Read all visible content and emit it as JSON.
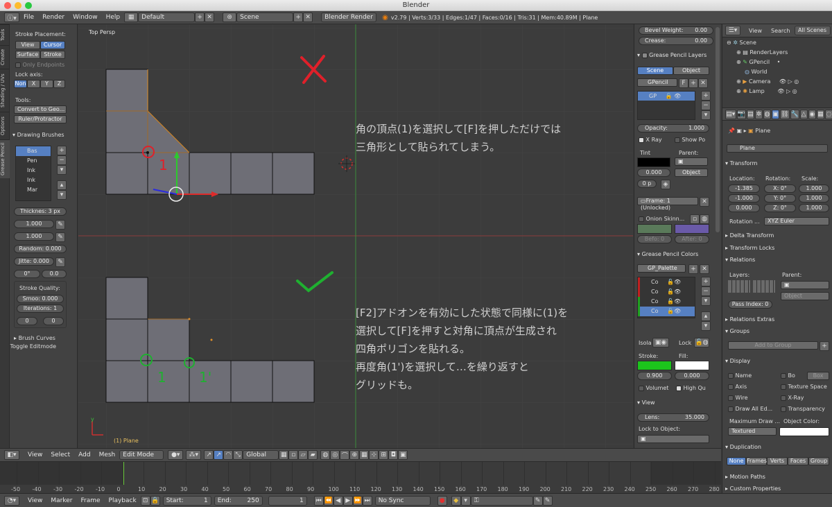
{
  "window": {
    "title": "Blender"
  },
  "topbar": {
    "menus": [
      "File",
      "Render",
      "Window",
      "Help"
    ],
    "layout": "Default",
    "scene": "Scene",
    "engine": "Blender Render",
    "stats": "v2.79 | Verts:3/33 | Edges:1/47 | Faces:0/16 | Tris:31 | Mem:40.89M | Plane"
  },
  "toolshelf": {
    "tabs": [
      "Tools",
      "Create",
      "Shading / UVs",
      "Options",
      "Grease Pencil"
    ],
    "stroke_placement": "Stroke Placement:",
    "view": "View",
    "cursor": "Cursor",
    "surface": "Surface",
    "stroke": "Stroke",
    "only_endpoints": "Only Endpoints",
    "lock_axis": "Lock axis:",
    "axes": [
      "Non",
      "X",
      "Y",
      "Z"
    ],
    "tools_label": "Tools:",
    "convert": "Convert to Geo...",
    "ruler": "Ruler/Protractor",
    "drawing_brushes": "Drawing Brushes",
    "brushes": [
      "Bas",
      "Pen",
      "Ink",
      "Ink",
      "Mar"
    ],
    "thickness": "Thicknes: 3 px",
    "val1": "1.000",
    "val2": "1.000",
    "random": "Random: 0.000",
    "jitter": "Jitte: 0.000",
    "angle": "0°",
    "angle_val": "0.0",
    "stroke_quality": "Stroke Quality:",
    "smooth": "Smoo: 0.000",
    "iterations_label": "Iterations:",
    "iterations": "1",
    "q1": "0",
    "q2": "0",
    "brush_curves": "Brush Curves",
    "toggle_editmode": "Toggle Editmode"
  },
  "viewport": {
    "label": "Top Persp",
    "object_label": "(1) Plane",
    "text1": [
      "角の頂点(1)を選択して[F]を押しただけでは",
      "三角形として貼られてしまう。"
    ],
    "text2": [
      "[F2]アドオンを有効にした状態で同様に(1)を",
      "選択して[F]を押すと対角に頂点が生成され",
      "四角ポリゴンを貼れる。",
      "再度角(1')を選択して…を繰り返すと",
      "グリッドも。"
    ],
    "mark1": "1",
    "mark2": "1",
    "mark3": "1'",
    "axis_y": "y",
    "colors": {
      "bad": "#e0202a",
      "good": "#1fb030",
      "face": "#6e6e76"
    }
  },
  "viewport_header": {
    "menus": [
      "View",
      "Select",
      "Add",
      "Mesh"
    ],
    "mode": "Edit Mode",
    "orientation": "Global"
  },
  "timeline": {
    "ticks": [
      "-50",
      "-40",
      "-30",
      "-20",
      "-10",
      "0",
      "10",
      "20",
      "30",
      "40",
      "50",
      "60",
      "70",
      "80",
      "90",
      "100",
      "110",
      "120",
      "130",
      "140",
      "150",
      "160",
      "170",
      "180",
      "190",
      "200",
      "210",
      "220",
      "230",
      "240",
      "250",
      "260",
      "270",
      "280"
    ]
  },
  "bottombar": {
    "menus": [
      "View",
      "Marker",
      "Frame",
      "Playback"
    ],
    "start_label": "Start:",
    "start": "1",
    "end_label": "End:",
    "end": "250",
    "current": "1",
    "sync": "No Sync"
  },
  "npanel": {
    "bevel_weight": "Bevel Weight:",
    "bevel_val": "0.00",
    "crease": "Crease:",
    "crease_val": "0.00",
    "gp_layers": "Grease Pencil Layers",
    "scene_btn": "Scene",
    "object_btn": "Object",
    "gpencil": "GPencil",
    "f_btn": "F",
    "layer": "GP",
    "opacity": "Opacity:",
    "opacity_val": "1.000",
    "xray": "X Ray",
    "showpo": "Show Po",
    "tint": "Tint",
    "parent": "Parent:",
    "tint_val": "0.000",
    "object_sel": "Object",
    "px": "0 p",
    "frame": "Frame: 1 (Unlocked)",
    "onion": "Onion Skinn...",
    "before": "Befo: 0",
    "after": "After: 0",
    "gp_colors": "Grease Pencil Colors",
    "palette": "GP_Palette",
    "color_items": [
      "Co",
      "Co",
      "Co",
      "Co"
    ],
    "isola": "Isola",
    "lock": "Lock",
    "stroke": "Stroke:",
    "fill": "Fill:",
    "stroke_val": "0.900",
    "fill_val": "0.000",
    "volumet": "Volumet",
    "highqu": "High Qu",
    "view": "View",
    "lens": "Lens:",
    "lens_val": "35.000",
    "lock_obj": "Lock to Object:"
  },
  "outliner": {
    "view": "View",
    "search": "Search",
    "all_scenes": "All Scenes",
    "items": [
      "Scene",
      "RenderLayers",
      "GPencil",
      "World",
      "Camera",
      "Lamp"
    ]
  },
  "properties": {
    "object_path": "Plane",
    "name": "Plane",
    "transform": "Transform",
    "location": "Location:",
    "rotation": "Rotation:",
    "scale": "Scale:",
    "loc": [
      "-1.385",
      "-1.000",
      "0.000"
    ],
    "rot": [
      "X: 0°",
      "Y: 0°",
      "Z: 0°"
    ],
    "scl": [
      "1.000",
      "1.000",
      "1.000"
    ],
    "rotation_mode_label": "Rotation ...",
    "rotation_mode": "XYZ Euler",
    "delta": "Delta Transform",
    "locks": "Transform Locks",
    "relations": "Relations",
    "layers": "Layers:",
    "parent": "Parent:",
    "pass_index": "Pass Index:",
    "pass_val": "0",
    "parent_type": "Object",
    "relations_extras": "Relations Extras",
    "groups": "Groups",
    "add_group": "Add to Group",
    "display": "Display",
    "name_chk": "Name",
    "bo_chk": "Bo",
    "box": "Box",
    "axis_chk": "Axis",
    "texspace": "Texture Space",
    "wire": "Wire",
    "xray": "X-Ray",
    "draw_all": "Draw All Ed...",
    "transparency": "Transparency",
    "max_draw": "Maximum Draw ...",
    "obj_color": "Object Color:",
    "textured": "Textured",
    "duplication": "Duplication",
    "dup": [
      "None",
      "Frames",
      "Verts",
      "Faces",
      "Group"
    ],
    "motion_paths": "Motion Paths",
    "custom_props": "Custom Properties"
  }
}
